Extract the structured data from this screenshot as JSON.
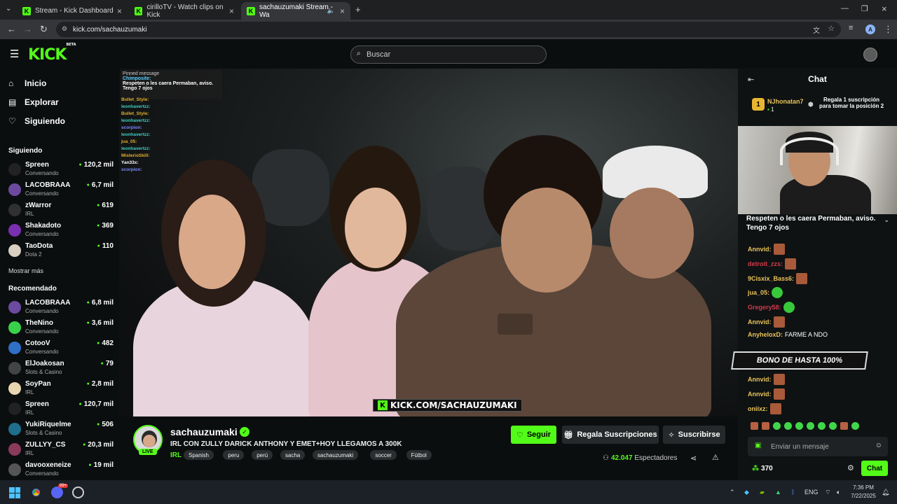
{
  "browser": {
    "tabs": [
      {
        "title": "Stream - Kick Dashboard"
      },
      {
        "title": "cirilloTV - Watch clips on Kick"
      },
      {
        "title": "sachauzumaki Stream - Wa"
      }
    ],
    "url": "kick.com/sachauzumaki",
    "profile_initial": "A"
  },
  "header": {
    "logo": "KICK",
    "logo_badge": "BETA",
    "search_placeholder": "Buscar"
  },
  "sidebar": {
    "nav": [
      {
        "label": "Inicio",
        "icon": "home-icon"
      },
      {
        "label": "Explorar",
        "icon": "browse-icon"
      },
      {
        "label": "Siguiendo",
        "icon": "heart-icon"
      }
    ],
    "following_title": "Siguiendo",
    "following": [
      {
        "name": "Spreen",
        "category": "Conversando",
        "viewers": "120,2 mil",
        "color": "#222"
      },
      {
        "name": "LACOBRAAA",
        "category": "Conversando",
        "viewers": "6,7 mil",
        "color": "#6c4aa0"
      },
      {
        "name": "zWarror",
        "category": "IRL",
        "viewers": "619",
        "color": "#303030"
      },
      {
        "name": "Shakadoto",
        "category": "Conversando",
        "viewers": "369",
        "color": "#7a2fb0"
      },
      {
        "name": "TaoDota",
        "category": "Dota 2",
        "viewers": "110",
        "color": "#d8cfc0"
      }
    ],
    "more_label": "Mostrar más",
    "recommended_title": "Recomendado",
    "recommended": [
      {
        "name": "LACOBRAAA",
        "category": "Conversando",
        "viewers": "6,8 mil",
        "color": "#6c4aa0"
      },
      {
        "name": "TheNino",
        "category": "Conversando",
        "viewers": "3,6 mil",
        "color": "#3ad14a"
      },
      {
        "name": "CotooV",
        "category": "Conversando",
        "viewers": "482",
        "color": "#2f6fc7"
      },
      {
        "name": "ElJoakosan",
        "category": "Slots & Casino",
        "viewers": "79",
        "color": "#444"
      },
      {
        "name": "SoyPan",
        "category": "IRL",
        "viewers": "2,8 mil",
        "color": "#e8d6b0"
      },
      {
        "name": "Spreen",
        "category": "IRL",
        "viewers": "120,7 mil",
        "color": "#222"
      },
      {
        "name": "YukiRiquelme",
        "category": "Slots & Casino",
        "viewers": "506",
        "color": "#1f6e8c"
      },
      {
        "name": "ZULLYY_CS",
        "category": "IRL",
        "viewers": "20,3 mil",
        "color": "#8a3a5a"
      },
      {
        "name": "davooxeneize",
        "category": "Conversando",
        "viewers": "19 mil",
        "color": "#555"
      }
    ]
  },
  "video": {
    "pinned_label": "Pinned message",
    "pinned_user": "Chimposite:",
    "pinned_text": "Respeten o les caera Permaban, aviso. Tengo 7 ojos",
    "overlay_chat": [
      {
        "user": "Bullet_Style:",
        "color": "#e0b030"
      },
      {
        "user": "leonhavertzz:",
        "color": "#3fd0c0"
      },
      {
        "user": "Bullet_Style:",
        "color": "#e0b030"
      },
      {
        "user": "leonhavertzz:",
        "color": "#3fd0c0"
      },
      {
        "user": "scorpion:",
        "color": "#7a8aff"
      },
      {
        "user": "leonhavertzz:",
        "color": "#3fd0c0"
      },
      {
        "user": "jua_05:",
        "color": "#e0b030"
      },
      {
        "user": "leonhavertzz:",
        "color": "#3fd0c0"
      },
      {
        "user": "MisterioSkill:",
        "color": "#e0b030"
      },
      {
        "user": "Yan33x:",
        "color": "#ffffff"
      },
      {
        "user": "scorpion:",
        "color": "#7a8aff"
      }
    ],
    "watermark": "KICK.COM/SACHAUZUMAKI"
  },
  "stream": {
    "channel": "sachauzumaki",
    "title": "IRL CON ZULLY DARICK ANTHONY Y EMET+HOY LLEGAMOS A 300K",
    "category": "IRL",
    "tags": [
      "Spanish",
      "peru",
      "perú",
      "sacha",
      "sachauzumaki",
      "soccer",
      "Fútbol"
    ],
    "live_label": "LIVE",
    "follow_label": "Seguir",
    "gift_label": "Regala Suscripciones",
    "subscribe_label": "Suscribirse",
    "viewers": "42.047",
    "viewers_label": "Espectadores"
  },
  "chat": {
    "title": "Chat",
    "top_gifter": "NJhonatan7",
    "top_gifter_rank": "1",
    "top_gifter_count": "1",
    "gift_prompt": "Regala 1 suscripción para tomar la posición 2",
    "pinned": "Respeten o les caera Permaban, aviso. Tengo 7 ojos",
    "messages": [
      {
        "user": "Annvid:",
        "color": "#e8c25a",
        "text": "",
        "emote": "r"
      },
      {
        "user": "detroit_zzs:",
        "color": "#d23a4a",
        "text": "",
        "emote": "r"
      },
      {
        "user": "9Cisxix_Bass6:",
        "color": "#e8c25a",
        "text": "",
        "emote": "r"
      },
      {
        "user": "jua_05:",
        "color": "#e8c25a",
        "text": "",
        "emote": "g"
      },
      {
        "user": "Gregery58:",
        "color": "#d23a4a",
        "text": "",
        "emote": "g"
      },
      {
        "user": "Annvid:",
        "color": "#e8c25a",
        "text": "",
        "emote": "r"
      },
      {
        "user": "AnyheloxD:",
        "color": "#e8c25a",
        "text": "FARME A NDO",
        "emote": ""
      },
      {
        "user": "Annvid:",
        "color": "#e8c25a",
        "text": "",
        "emote": "r"
      },
      {
        "user": "Annvid:",
        "color": "#e8c25a",
        "text": "",
        "emote": "r"
      },
      {
        "user": "oniixz:",
        "color": "#e8c25a",
        "text": "",
        "emote": "r"
      }
    ],
    "promo": "BONO DE HASTA 100%",
    "input_placeholder": "Enviar un mensaje",
    "points": "370",
    "send_label": "Chat"
  },
  "taskbar": {
    "lang": "ENG",
    "time": "7:36 PM",
    "date": "7/22/2025",
    "discord_badge": "99+"
  }
}
